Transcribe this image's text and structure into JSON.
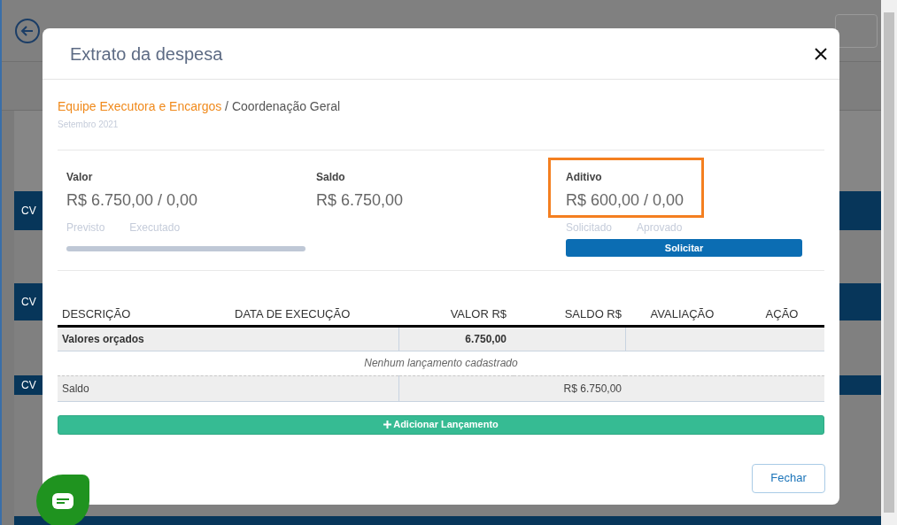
{
  "background": {
    "group_labels": [
      "CV",
      "CV",
      "CV"
    ]
  },
  "modal": {
    "title": "Extrato da despesa",
    "breadcrumb": {
      "category": "Equipe Executora e Encargos",
      "separator": " / ",
      "item": "Coordenação Geral"
    },
    "period": "Setembro 2021",
    "summary": [
      {
        "kind": "progress",
        "label": "Valor",
        "value": "R$ 6.750,00 / 0,00",
        "captions": [
          "Previsto",
          "Executado"
        ],
        "level": 0,
        "highlighted": false
      },
      {
        "kind": "plain",
        "label": "Saldo",
        "value": "R$ 6.750,00",
        "highlighted": false
      },
      {
        "kind": "action",
        "label": "Aditivo",
        "value": "R$ 600,00 / 0,00",
        "captions": [
          "Solicitado",
          "Aprovado"
        ],
        "button": "Solicitar",
        "highlighted": true
      }
    ],
    "table": {
      "columns": [
        "DESCRIÇÃO",
        "DATA DE EXECUÇÃO",
        "VALOR R$",
        "SALDO R$",
        "AVALIAÇÃO",
        "AÇÃO"
      ],
      "budget_row": {
        "label": "Valores orçados",
        "value": "6.750,00"
      },
      "empty_message": "Nenhum lançamento cadastrado",
      "balance_row": {
        "label": "Saldo",
        "value": "R$ 6.750,00"
      }
    },
    "add_button": "Adicionar Lançamento",
    "close_button": "Fechar"
  }
}
